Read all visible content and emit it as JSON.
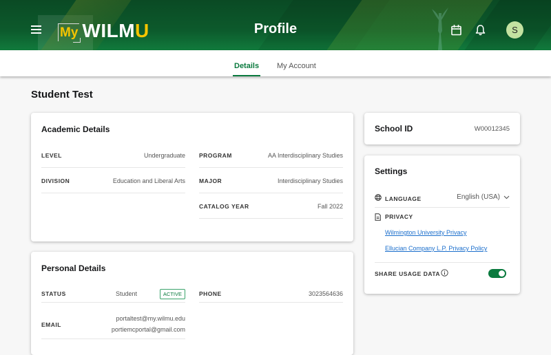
{
  "header": {
    "logo": {
      "my": "My",
      "wilm": "WILM",
      "u": "U"
    },
    "title": "Profile",
    "icons": [
      "menu-icon",
      "calendar-icon",
      "bell-icon"
    ],
    "avatar_initial": "S",
    "colors": {
      "brand_green": "#0a7a3e",
      "brand_gold": "#f5c400",
      "avatar_bg": "#c3e2a1"
    }
  },
  "tabs": [
    {
      "label": "Details",
      "active": true
    },
    {
      "label": "My Account",
      "active": false
    }
  ],
  "student_name": "Student Test",
  "academic": {
    "title": "Academic Details",
    "left": [
      {
        "label": "LEVEL",
        "value": "Undergraduate"
      },
      {
        "label": "DIVISION",
        "value": "Education and Liberal Arts"
      }
    ],
    "right": [
      {
        "label": "PROGRAM",
        "value": "AA Interdisciplinary Studies"
      },
      {
        "label": "MAJOR",
        "value": "Interdisciplinary Studies"
      },
      {
        "label": "CATALOG YEAR",
        "value": "Fall 2022"
      }
    ]
  },
  "personal": {
    "title": "Personal Details",
    "status": {
      "label": "STATUS",
      "value": "Student",
      "badge": "ACTIVE"
    },
    "email": {
      "label": "EMAIL",
      "values": [
        "portaltest@my.wilmu.edu",
        "portiemcportal@gmail.com"
      ]
    },
    "phone": {
      "label": "PHONE",
      "value": "3023564636"
    }
  },
  "school_id": {
    "label": "School ID",
    "value": "W00012345"
  },
  "settings": {
    "title": "Settings",
    "language": {
      "label": "LANGUAGE",
      "value": "English (USA)"
    },
    "privacy": {
      "label": "PRIVACY",
      "links": [
        "Wilmington University Privacy",
        "Ellucian Company L.P. Privacy Policy"
      ]
    },
    "share_usage": {
      "label": "SHARE USAGE DATA",
      "enabled": true
    }
  }
}
